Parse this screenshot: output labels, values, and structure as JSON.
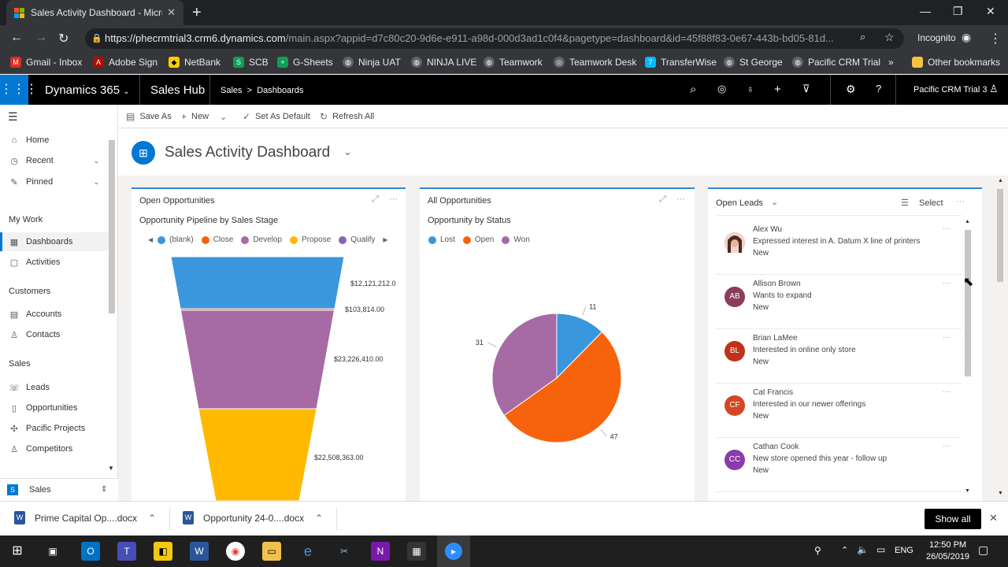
{
  "browser": {
    "tab_title": "Sales Activity Dashboard - Micro",
    "url_host": "https://phecrmtrial3.crm6.dynamics.com",
    "url_path": "/main.aspx?appid=d7c80c20-9d6e-e911-a98d-000d3ad1c0f4&pagetype=dashboard&id=45f88f83-0e67-443b-bd05-81d...",
    "incognito_label": "Incognito",
    "bookmarks": [
      "Gmail - Inbox",
      "Adobe Sign",
      "NetBank",
      "SCB",
      "G-Sheets",
      "Ninja UAT",
      "NINJA LIVE",
      "Teamwork",
      "Teamwork Desk",
      "TransferWise",
      "St George",
      "Pacific CRM Trial"
    ],
    "other_bookmarks": "Other bookmarks",
    "more_bookmarks": "»"
  },
  "topnav": {
    "app": "Dynamics 365",
    "hub": "Sales Hub",
    "crumb_area": "Sales",
    "crumb_sep": ">",
    "crumb_page": "Dashboards",
    "org": "Pacific CRM Trial 3"
  },
  "sidebar": {
    "home": "Home",
    "recent": "Recent",
    "pinned": "Pinned",
    "mywork_head": "My Work",
    "dashboards": "Dashboards",
    "activities": "Activities",
    "customers_head": "Customers",
    "accounts": "Accounts",
    "contacts": "Contacts",
    "sales_head": "Sales",
    "leads": "Leads",
    "opportunities": "Opportunities",
    "pacific_projects": "Pacific Projects",
    "competitors": "Competitors",
    "area_letter": "S",
    "area": "Sales"
  },
  "commandbar": {
    "save_as": "Save As",
    "new": "New",
    "set_default": "Set As Default",
    "refresh_all": "Refresh All"
  },
  "dashboard": {
    "title": "Sales Activity Dashboard"
  },
  "panel_open_opps": {
    "title": "Open Opportunities",
    "subtitle": "Opportunity Pipeline by Sales Stage",
    "legend": [
      "(blank)",
      "Close",
      "Develop",
      "Propose",
      "Qualify"
    ],
    "legend_colors": [
      "#3a96dd",
      "#f7630c",
      "#a66aa5",
      "#ffb900",
      "#8764b8"
    ]
  },
  "panel_all_opps": {
    "title": "All Opportunities",
    "subtitle": "Opportunity by Status",
    "legend": [
      "Lost",
      "Open",
      "Won"
    ],
    "legend_colors": [
      "#3a96dd",
      "#f7630c",
      "#a66aa5"
    ]
  },
  "panel_leads": {
    "title": "Open Leads",
    "select": "Select",
    "items": [
      {
        "initials": "",
        "name": "Alex Wu",
        "desc": "Expressed interest in A. Datum X line of printers",
        "status": "New",
        "color": "#b05a4a"
      },
      {
        "initials": "AB",
        "name": "Allison Brown",
        "desc": "Wants to expand",
        "status": "New",
        "color": "#8a3d5a"
      },
      {
        "initials": "BL",
        "name": "Brian LaMee",
        "desc": "Interested in online only store",
        "status": "New",
        "color": "#c0311a"
      },
      {
        "initials": "CF",
        "name": "Cat Francis",
        "desc": "Interested in our newer offerings",
        "status": "New",
        "color": "#d24726"
      },
      {
        "initials": "CC",
        "name": "Cathan Cook",
        "desc": "New store opened this year - follow up",
        "status": "New",
        "color": "#8c3bab"
      }
    ]
  },
  "chart_data": [
    {
      "type": "funnel",
      "title": "Opportunity Pipeline by Sales Stage",
      "categories": [
        "(blank)",
        "Close",
        "Develop",
        "Propose"
      ],
      "labels": [
        "$12,121,212.0",
        "$103,814.00",
        "$23,226,410.00",
        "$22,508,363.00"
      ],
      "values": [
        12121212.0,
        103814.0,
        23226410.0,
        22508363.0
      ],
      "colors": [
        "#3a96dd",
        "#f7630c",
        "#a66aa5",
        "#ffb900"
      ]
    },
    {
      "type": "pie",
      "title": "Opportunity by Status",
      "categories": [
        "Lost",
        "Open",
        "Won"
      ],
      "values": [
        11,
        47,
        31
      ],
      "colors": [
        "#3a96dd",
        "#f7630c",
        "#a66aa5"
      ]
    }
  ],
  "downloads": {
    "file1": "Prime Capital Op....docx",
    "file2": "Opportunity 24-0....docx",
    "show_all": "Show all"
  },
  "taskbar": {
    "lang": "ENG",
    "time": "12:50 PM",
    "date": "26/05/2019"
  }
}
